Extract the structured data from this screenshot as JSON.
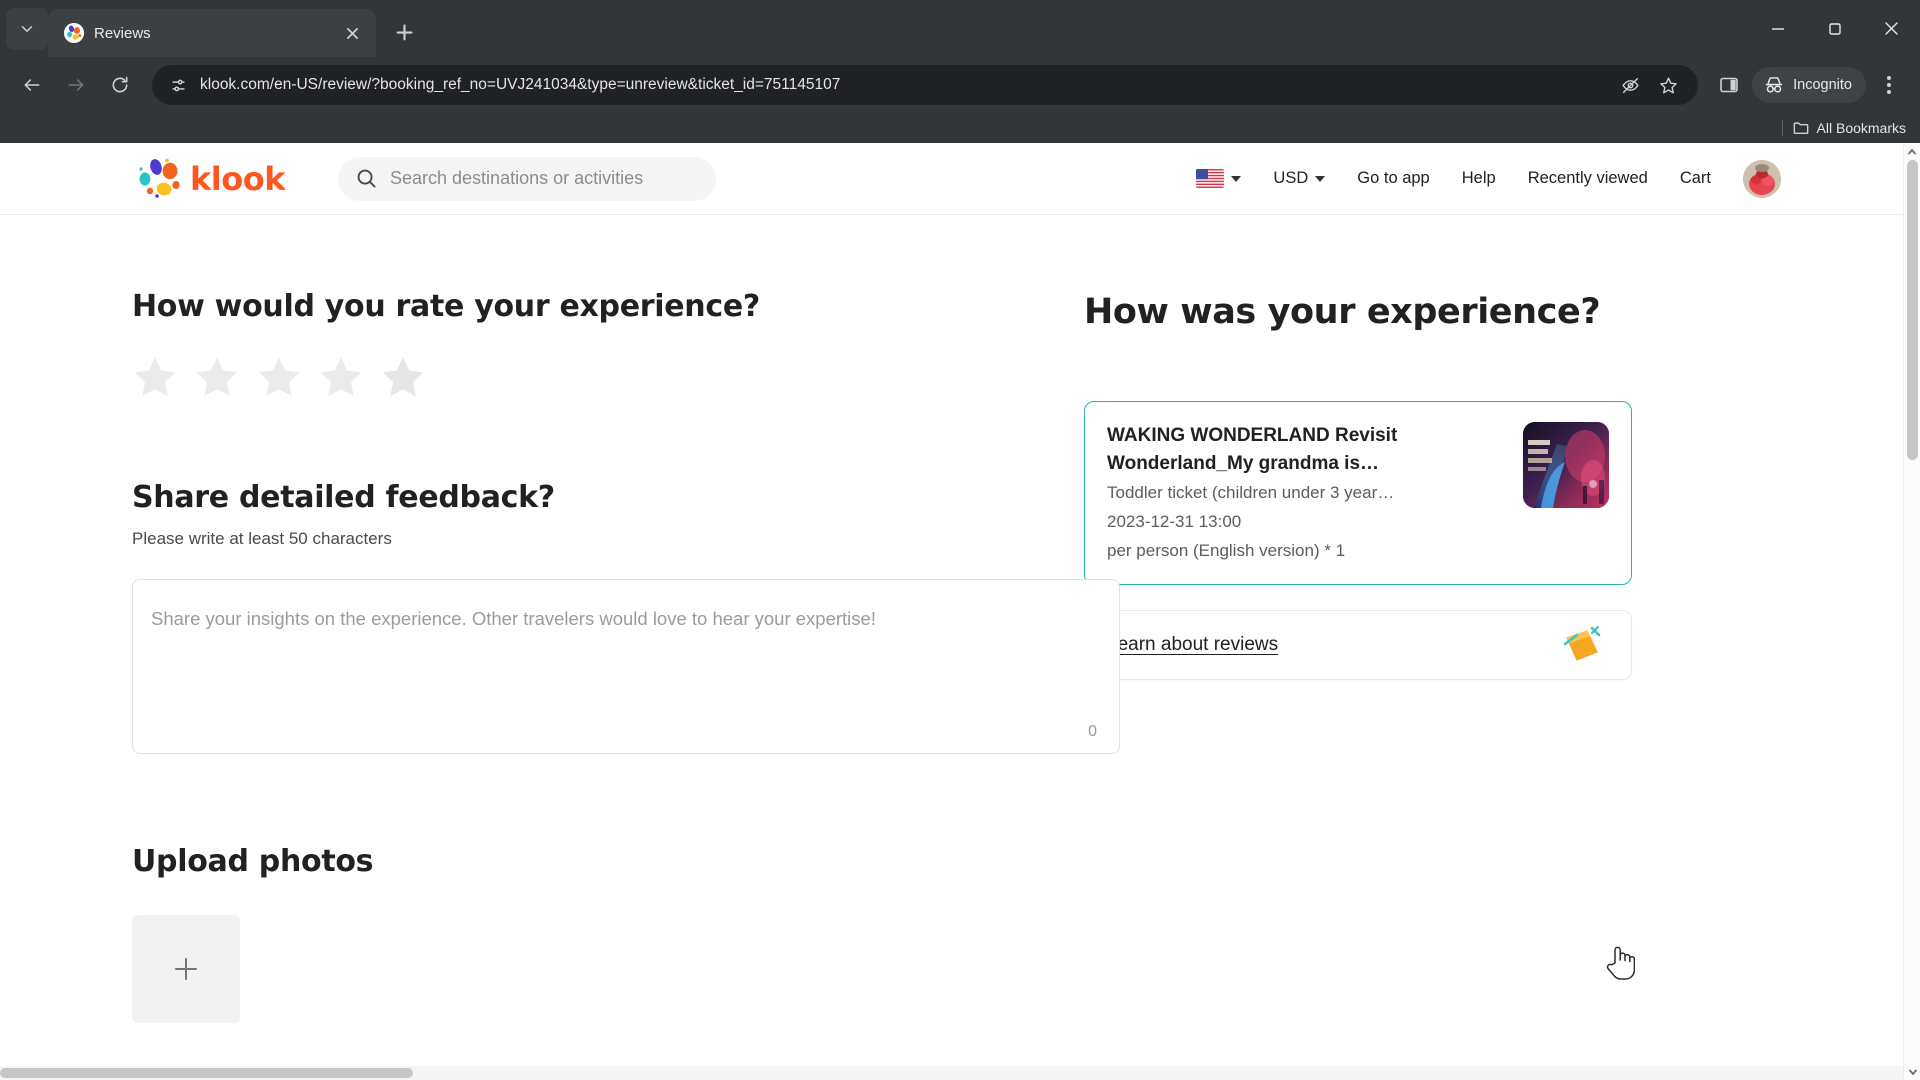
{
  "browser": {
    "tab": {
      "title": "Reviews",
      "favicon_name": "klook-favicon"
    },
    "url": "klook.com/en-US/review/?booking_ref_no=UVJ241034&type=unreview&ticket_id=751145107",
    "incognito_label": "Incognito",
    "bookmarks_label": "All Bookmarks",
    "nav": {
      "back": "back-arrow",
      "forward": "forward-arrow",
      "reload": "reload"
    },
    "window_controls": {
      "minimize": "minimize",
      "maximize": "maximize",
      "close": "close"
    }
  },
  "site_header": {
    "logo_text": "klook",
    "search_placeholder": "Search destinations or activities",
    "language_flag": "us-flag",
    "currency": "USD",
    "links": [
      "Go to app",
      "Help",
      "Recently viewed",
      "Cart"
    ],
    "go_to_app": "Go to app",
    "help": "Help",
    "recently_viewed": "Recently viewed",
    "cart": "Cart"
  },
  "main": {
    "rating_heading": "How would you rate your experience?",
    "stars_total": 5,
    "stars_selected": 0,
    "feedback_heading": "Share detailed feedback?",
    "feedback_note": "Please write at least 50 characters",
    "feedback_placeholder": "Share your insights on the experience. Other travelers would love to hear your expertise!",
    "feedback_value": "",
    "char_count": "0",
    "upload_heading": "Upload photos",
    "upload_add_icon": "plus-icon"
  },
  "sidebar": {
    "heading": "How was your experience?",
    "product": {
      "title": "WAKING WONDERLAND Revisit Wonderland_My grandma is…",
      "package": "Toddler ticket (children under 3 year…",
      "datetime": "2023-12-31 13:00",
      "unit": "per person (English version) * 1",
      "thumbnail_name": "product-thumbnail"
    },
    "learn_link": "Learn about reviews",
    "learn_icon": "notepad-icon"
  },
  "colors": {
    "brand_orange": "#ff5722",
    "accent_teal": "#2bb3a3",
    "text_primary": "#212121",
    "text_muted": "#9b9b9b",
    "chrome_bg": "#323639"
  }
}
